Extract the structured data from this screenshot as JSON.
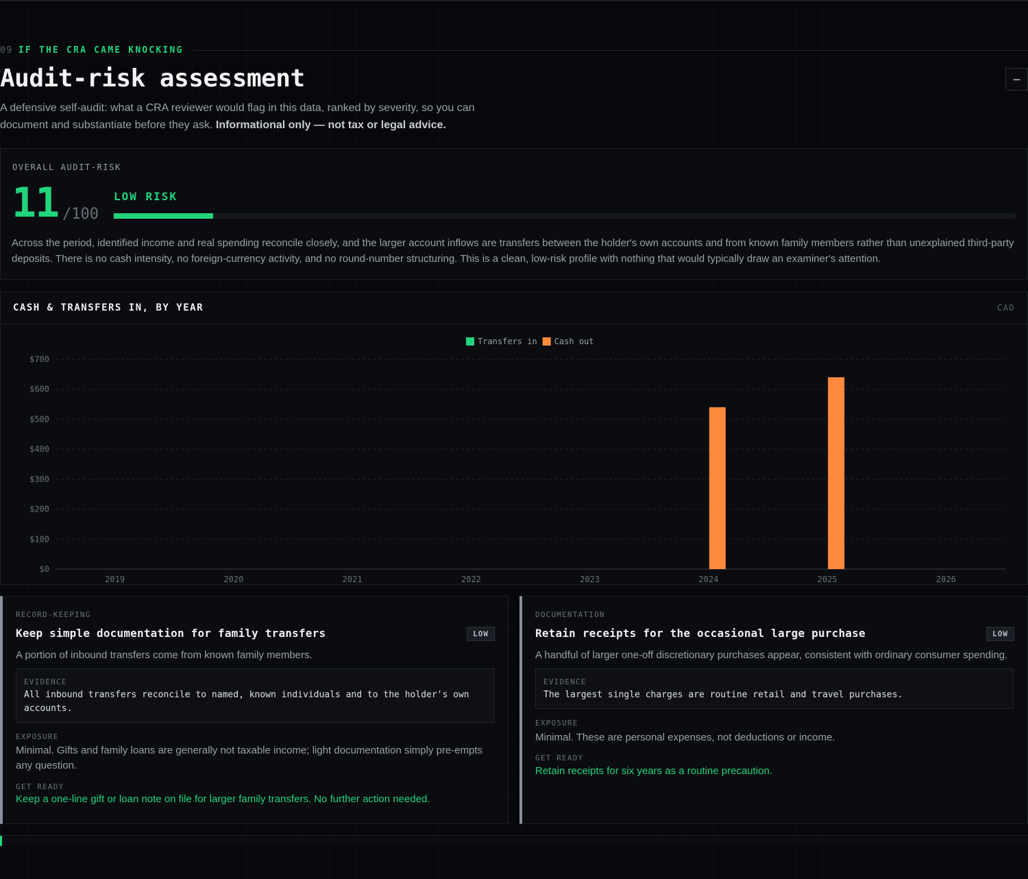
{
  "section": {
    "number": "09",
    "eyebrow": "IF THE CRA CAME KNOCKING",
    "title": "Audit-risk assessment",
    "intro": "A defensive self-audit: what a CRA reviewer would flag in this data, ranked by severity, so you can document and substantiate before they ask.",
    "disclaimer": "Informational only — not tax or legal advice.",
    "collapse_label": "–"
  },
  "risk": {
    "label": "OVERALL AUDIT-RISK",
    "score": "11",
    "max": "/100",
    "score_fraction": 0.11,
    "level": "LOW RISK",
    "summary": "Across the period, identified income and real spending reconcile closely, and the larger account inflows are transfers between the holder's own accounts and from known family members rather than unexplained third-party deposits. There is no cash intensity, no foreign-currency activity, and no round-number structuring. This is a clean, low-risk profile with nothing that would typically draw an examiner's attention."
  },
  "chart": {
    "title": "CASH & TRANSFERS IN, BY YEAR",
    "unit": "CAD"
  },
  "chart_data": {
    "type": "bar",
    "categories": [
      "2019",
      "2020",
      "2021",
      "2022",
      "2023",
      "2024",
      "2025",
      "2026"
    ],
    "series": [
      {
        "name": "Transfers in",
        "color": "#22d47c",
        "values": [
          0,
          0,
          0,
          0,
          0,
          0,
          0,
          0
        ]
      },
      {
        "name": "Cash out",
        "color": "#ff8a3d",
        "values": [
          0,
          0,
          0,
          0,
          0,
          540,
          640,
          0
        ]
      }
    ],
    "y_ticks": [
      "$0",
      "$100",
      "$200",
      "$300",
      "$400",
      "$500",
      "$600",
      "$700"
    ],
    "ylim": [
      0,
      700
    ],
    "grid": true,
    "legend": "top-center"
  },
  "cards": [
    {
      "category": "RECORD-KEEPING",
      "title": "Keep simple documentation for family transfers",
      "severity": "LOW",
      "description": "A portion of inbound transfers come from known family members.",
      "evidence_label": "EVIDENCE",
      "evidence": "All inbound transfers reconcile to named, known individuals and to the holder's own accounts.",
      "exposure_label": "EXPOSURE",
      "exposure": "Minimal. Gifts and family loans are generally not taxable income; light documentation simply pre-empts any question.",
      "ready_label": "GET READY",
      "ready": "Keep a one-line gift or loan note on file for larger family transfers. No further action needed."
    },
    {
      "category": "DOCUMENTATION",
      "title": "Retain receipts for the occasional large purchase",
      "severity": "LOW",
      "description": "A handful of larger one-off discretionary purchases appear, consistent with ordinary consumer spending.",
      "evidence_label": "EVIDENCE",
      "evidence": "The largest single charges are routine retail and travel purchases.",
      "exposure_label": "EXPOSURE",
      "exposure": "Minimal. These are personal expenses, not deductions or income.",
      "ready_label": "GET READY",
      "ready": "Retain receipts for six years as a routine precaution."
    }
  ],
  "colors": {
    "accent": "#22d47c",
    "cash_out": "#ff8a3d",
    "background": "#07080b",
    "panel": "#0b0c10"
  }
}
